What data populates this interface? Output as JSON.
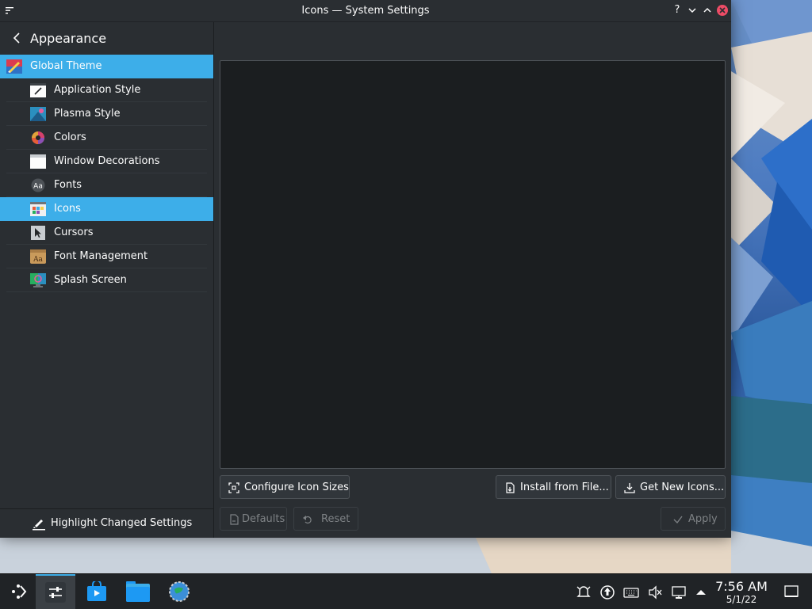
{
  "window": {
    "title": "Icons — System Settings"
  },
  "titlebar": {
    "help": "?",
    "minimize": "⌄",
    "maximize": "⌃"
  },
  "sidebar": {
    "header": "Appearance",
    "items": [
      {
        "label": "Global Theme",
        "icon": "global-theme-icon"
      },
      {
        "label": "Application Style",
        "icon": "application-style-icon"
      },
      {
        "label": "Plasma Style",
        "icon": "plasma-style-icon"
      },
      {
        "label": "Colors",
        "icon": "colors-icon"
      },
      {
        "label": "Window Decorations",
        "icon": "window-decorations-icon"
      },
      {
        "label": "Fonts",
        "icon": "fonts-icon"
      },
      {
        "label": "Icons",
        "icon": "icons-icon"
      },
      {
        "label": "Cursors",
        "icon": "cursors-icon"
      },
      {
        "label": "Font Management",
        "icon": "font-management-icon"
      },
      {
        "label": "Splash Screen",
        "icon": "splash-screen-icon"
      }
    ],
    "highlight_button": "Highlight Changed Settings"
  },
  "content": {
    "configure_sizes": "Configure Icon Sizes",
    "install_file": "Install from File...",
    "get_new": "Get New Icons...",
    "defaults": "Defaults",
    "reset": "Reset",
    "apply": "Apply"
  },
  "taskbar": {
    "time": "7:56 AM",
    "date": "5/1/22"
  },
  "colors": {
    "accent": "#3daee9",
    "window_bg": "#2a2e32",
    "panel_bg": "#1b1e20",
    "close": "#ed4c66"
  }
}
